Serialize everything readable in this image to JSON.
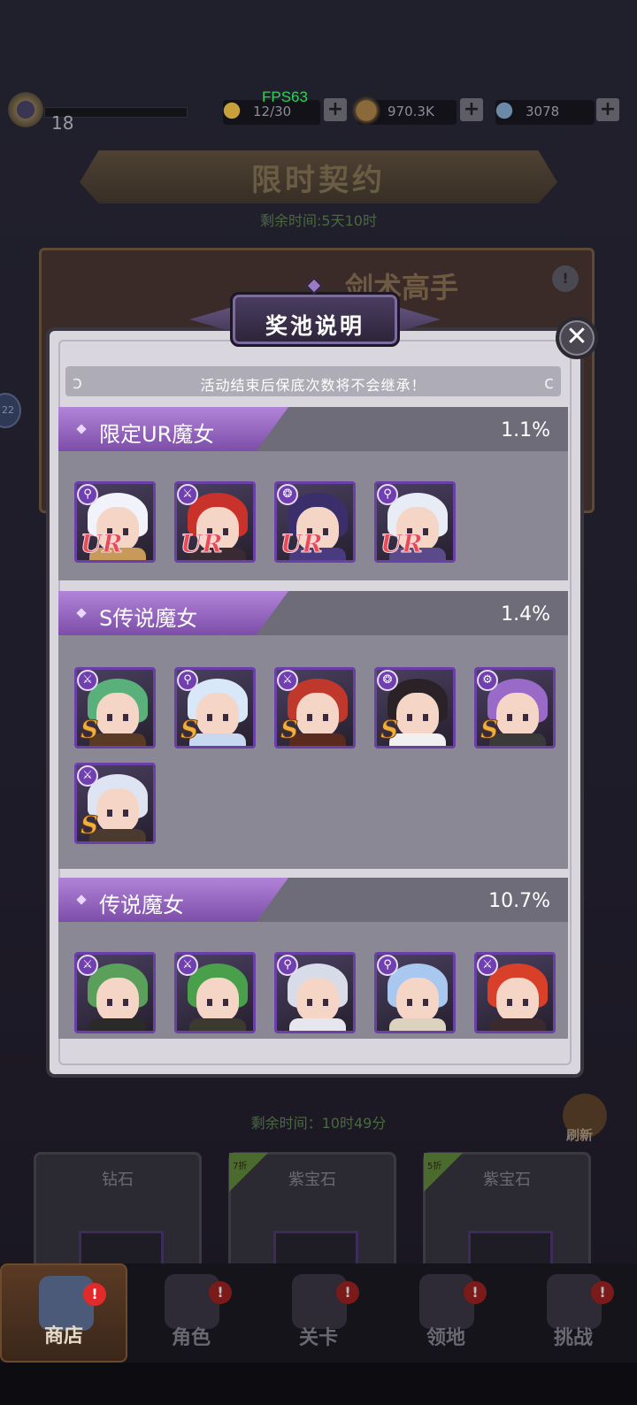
{
  "hud": {
    "fps": "FPS63",
    "level": "18",
    "energy": "12/30",
    "gold": "970.3K",
    "diamonds": "3078",
    "plus": "+"
  },
  "background": {
    "event_title": "限时契约",
    "event_timer": "剩余时间:5天10时",
    "banner_title": "剑术高手",
    "banner_info": "!",
    "side_badge": "22",
    "shop_timer": "剩余时间：10时49分",
    "refresh_label": "刷新",
    "shop_cards": [
      {
        "label": "钻石",
        "tag": ""
      },
      {
        "label": "紫宝石",
        "tag": "7折"
      },
      {
        "label": "紫宝石",
        "tag": "5折"
      }
    ]
  },
  "nav": {
    "items": [
      {
        "label": "商店",
        "active": true
      },
      {
        "label": "角色",
        "active": false
      },
      {
        "label": "关卡",
        "active": false
      },
      {
        "label": "领地",
        "active": false
      },
      {
        "label": "挑战",
        "active": false
      }
    ],
    "badge": "!"
  },
  "modal": {
    "title": "奖池说明",
    "close": "✕",
    "notice": "活动结束后保底次数将不会继承！",
    "sections": [
      {
        "title": "限定UR魔女",
        "rate": "1.1%",
        "characters": [
          {
            "rank": "UR",
            "type": "staff",
            "hair": "#f2f2fa",
            "body": "#c89a5a"
          },
          {
            "rank": "UR",
            "type": "sword",
            "hair": "#c8322a",
            "body": "#3a2a34"
          },
          {
            "rank": "UR",
            "type": "swirl",
            "hair": "#3a2f6a",
            "body": "#4a3a80"
          },
          {
            "rank": "UR",
            "type": "staff",
            "hair": "#e8ecf4",
            "body": "#5a4a8a"
          }
        ]
      },
      {
        "title": "S传说魔女",
        "rate": "1.4%",
        "characters": [
          {
            "rank": "S",
            "type": "sword",
            "hair": "#5ab07a",
            "body": "#5a3a24"
          },
          {
            "rank": "S",
            "type": "staff",
            "hair": "#d8e8f8",
            "body": "#c8d8f0"
          },
          {
            "rank": "S",
            "type": "sword",
            "hair": "#c0382c",
            "body": "#5a2a1e"
          },
          {
            "rank": "S",
            "type": "swirl",
            "hair": "#2a2226",
            "body": "#f0f0f0"
          },
          {
            "rank": "S",
            "type": "gear",
            "hair": "#9a6ac8",
            "body": "#3a3a3a"
          },
          {
            "rank": "S",
            "type": "sword",
            "hair": "#dfe4f2",
            "body": "#4a3a30"
          }
        ]
      },
      {
        "title": "传说魔女",
        "rate": "10.7%",
        "characters": [
          {
            "rank": "",
            "type": "sword",
            "hair": "#5aa05a",
            "body": "#2a2a2a"
          },
          {
            "rank": "",
            "type": "sword",
            "hair": "#4aa04a",
            "body": "#3a3a30"
          },
          {
            "rank": "",
            "type": "staff",
            "hair": "#d8dce8",
            "body": "#e6e6ee"
          },
          {
            "rank": "",
            "type": "staff",
            "hair": "#a8c8f0",
            "body": "#dcd2c0"
          },
          {
            "rank": "",
            "type": "sword",
            "hair": "#d8402a",
            "body": "#3a2a30"
          }
        ]
      }
    ]
  }
}
